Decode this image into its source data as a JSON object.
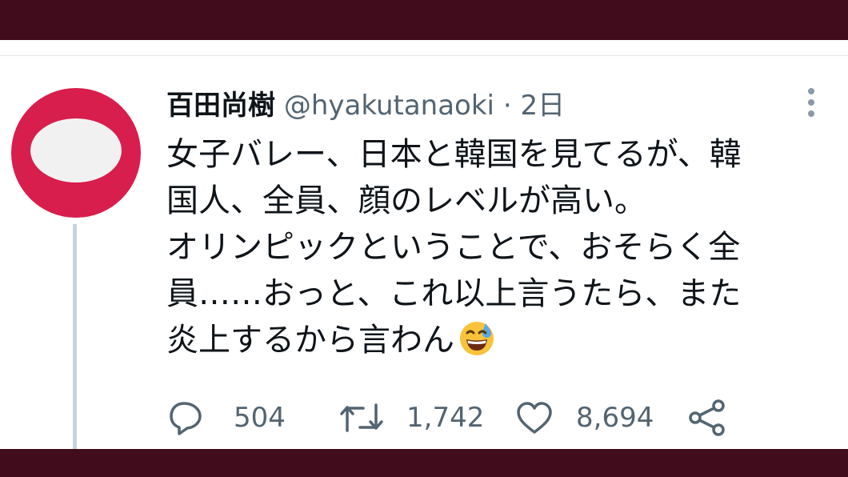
{
  "tweet": {
    "display_name": "百田尚樹",
    "handle": "@hyakutanaoki",
    "separator": "·",
    "time": "2日",
    "text_lines": [
      "女子バレー、日本と韓国を見てるが、韓",
      "国人、全員、顔のレベルが高い。",
      "オリンピックということで、おそらく全",
      "員……おっと、これ以上言うたら、また",
      "炎上するから言わん"
    ],
    "emoji": "grinning-sweat-emoji",
    "reply_count": "504",
    "retweet_count": "1,742",
    "like_count": "8,694"
  },
  "icons": {
    "more": "more-vertical-icon",
    "reply": "reply-icon",
    "retweet": "retweet-icon",
    "like": "heart-icon",
    "share": "share-icon"
  },
  "colors": {
    "band": "#410c1c",
    "avatar": "#d81e4c",
    "avatar_inner": "#f1f1f2",
    "text": "#0f1419",
    "secondary": "#536471",
    "icon": "#536471",
    "thread_line": "#c9d3db"
  }
}
